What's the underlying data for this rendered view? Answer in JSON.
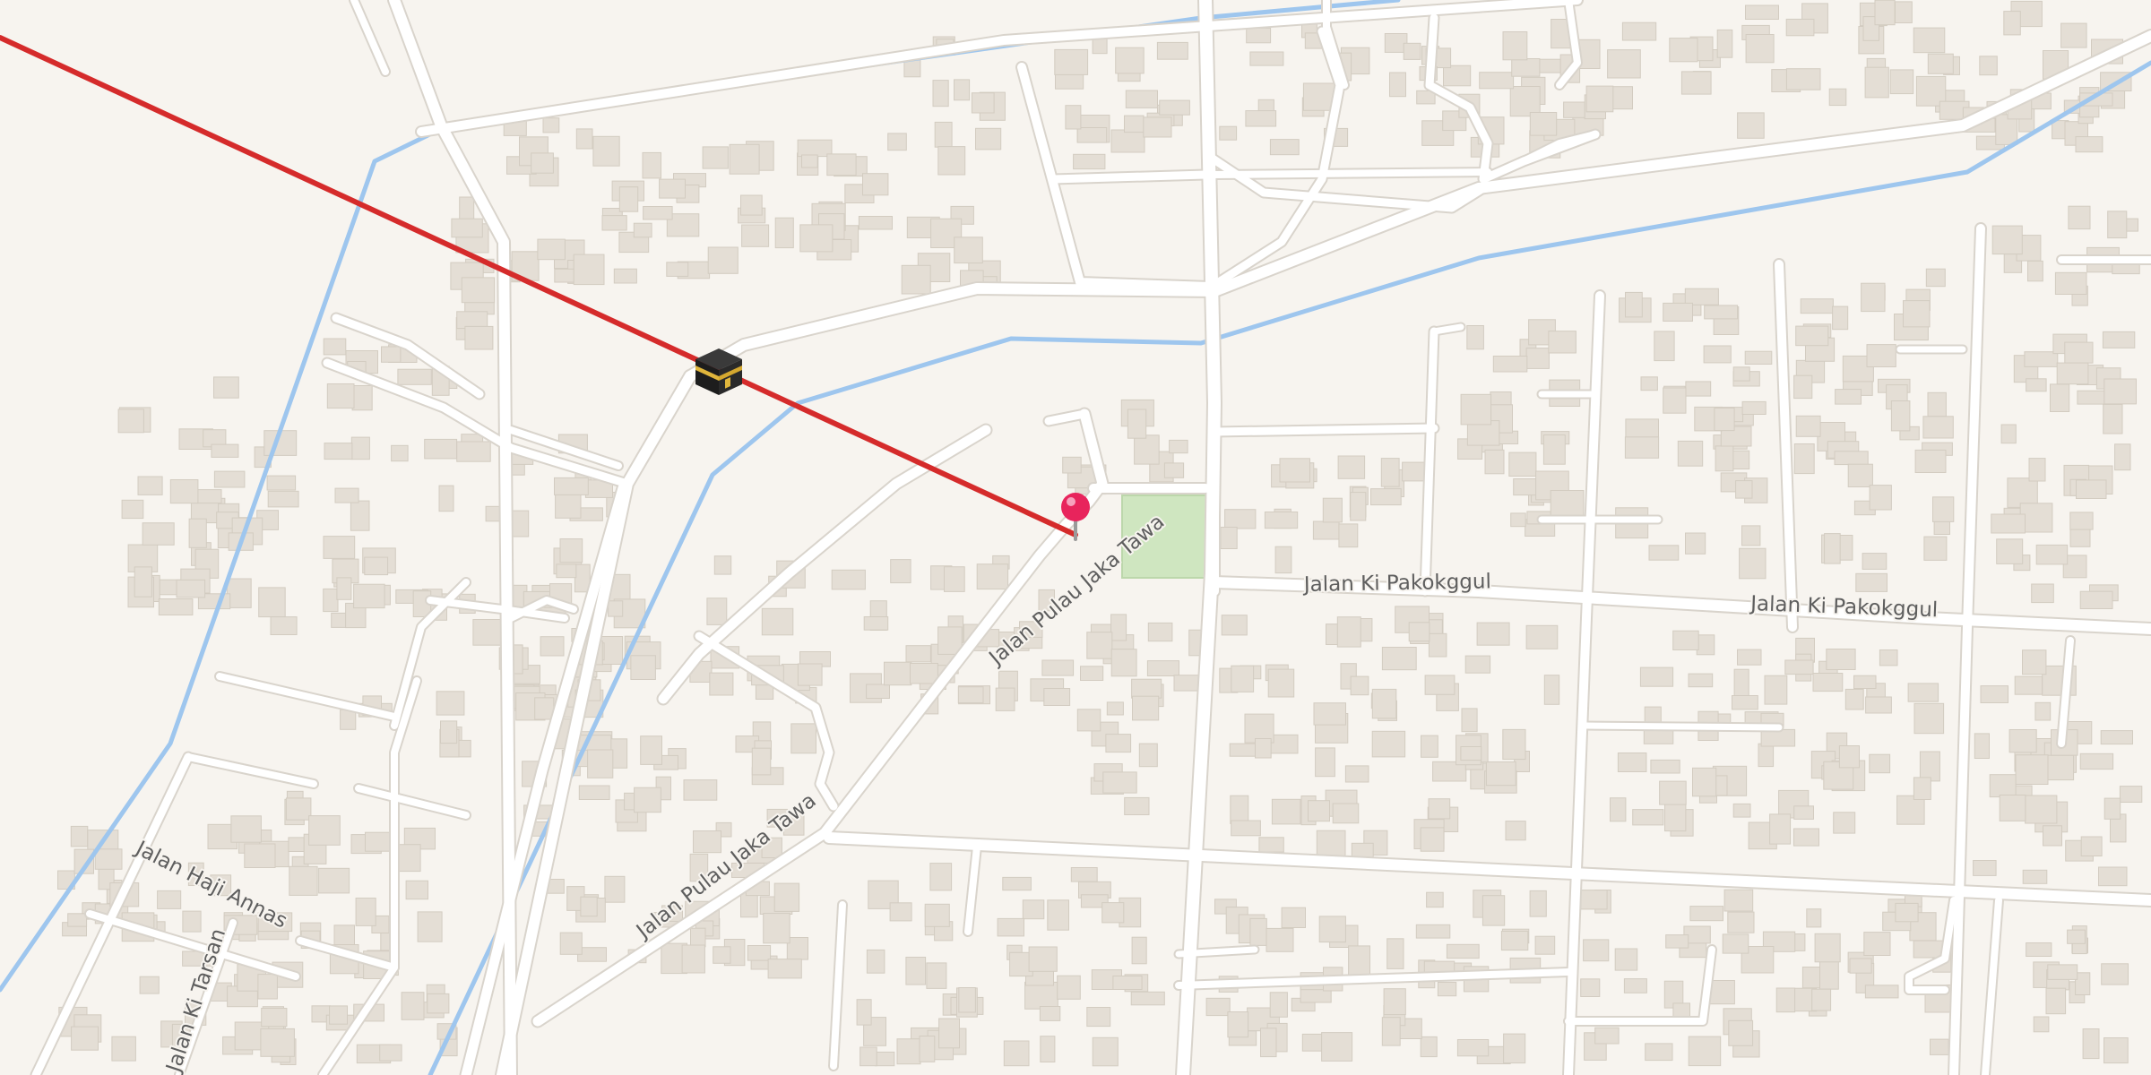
{
  "map": {
    "colors": {
      "land": "#f7f4ef",
      "road": "#ffffff",
      "road_edge": "#d9d4cc",
      "canal": "#9ec6ee",
      "building": "#e4ded5",
      "park": "#cfe6c0",
      "qibla_line": "#d52b2b",
      "pin": "#e8245c"
    },
    "markers": {
      "kaaba": {
        "icon": "kaaba-icon"
      },
      "location": {
        "icon": "map-pin-icon"
      }
    },
    "street_labels": [
      {
        "id": "pulau-jaka-tawa-upper",
        "text": "Jalan Pulau Jaka Tawa"
      },
      {
        "id": "pulau-jaka-tawa-lower",
        "text": "Jalan Pulau Jaka Tawa"
      },
      {
        "id": "ki-pakokggul-left",
        "text": "Jalan Ki Pakokggul"
      },
      {
        "id": "ki-pakokggul-right",
        "text": "Jalan Ki Pakokggul"
      },
      {
        "id": "haji-annas",
        "text": "Jalan Haji Annas"
      },
      {
        "id": "ki-tarsan",
        "text": "Jalan Ki Tarsan"
      }
    ]
  }
}
